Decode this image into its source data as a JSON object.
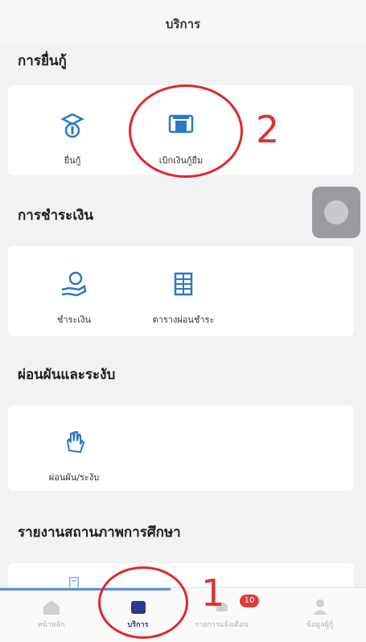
{
  "header": {
    "title": "บริการ"
  },
  "sections": [
    {
      "title": "การยื่นกู้",
      "items": [
        {
          "label": "ยื่นกู้",
          "icon": "graduation-coin-icon"
        },
        {
          "label": "เบิกเงินกู้ยืม",
          "icon": "atm-withdraw-icon"
        }
      ]
    },
    {
      "title": "การชำระเงิน",
      "items": [
        {
          "label": "ชำระเงิน",
          "icon": "hand-coin-icon"
        },
        {
          "label": "ตารางผ่อนชำระ",
          "icon": "schedule-table-icon"
        }
      ]
    },
    {
      "title": "ผ่อนผันและระงับ",
      "items": [
        {
          "label": "ผ่อนผัน/ระงับ",
          "icon": "hand-stop-icon"
        }
      ]
    },
    {
      "title": "รายงานสถานภาพการศึกษา",
      "items": [
        {
          "label": "",
          "icon": "document-report-icon"
        }
      ]
    }
  ],
  "annotations": {
    "step_1": "1",
    "step_2": "2"
  },
  "tabbar": {
    "tabs": [
      {
        "label": "หน้าหลัก",
        "icon": "home-icon"
      },
      {
        "label": "บริการ",
        "icon": "services-icon",
        "active": true
      },
      {
        "label": "รายการแจ้งเตือน",
        "icon": "notification-icon"
      },
      {
        "label": "ข้อมูลผู้กู้",
        "icon": "profile-icon"
      }
    ],
    "notification_count": "10"
  },
  "colors": {
    "accent": "#2b3a8f",
    "icon_blue": "#2e78c7",
    "annotation_red": "#e0282a",
    "badge_red": "#e23b3b"
  }
}
